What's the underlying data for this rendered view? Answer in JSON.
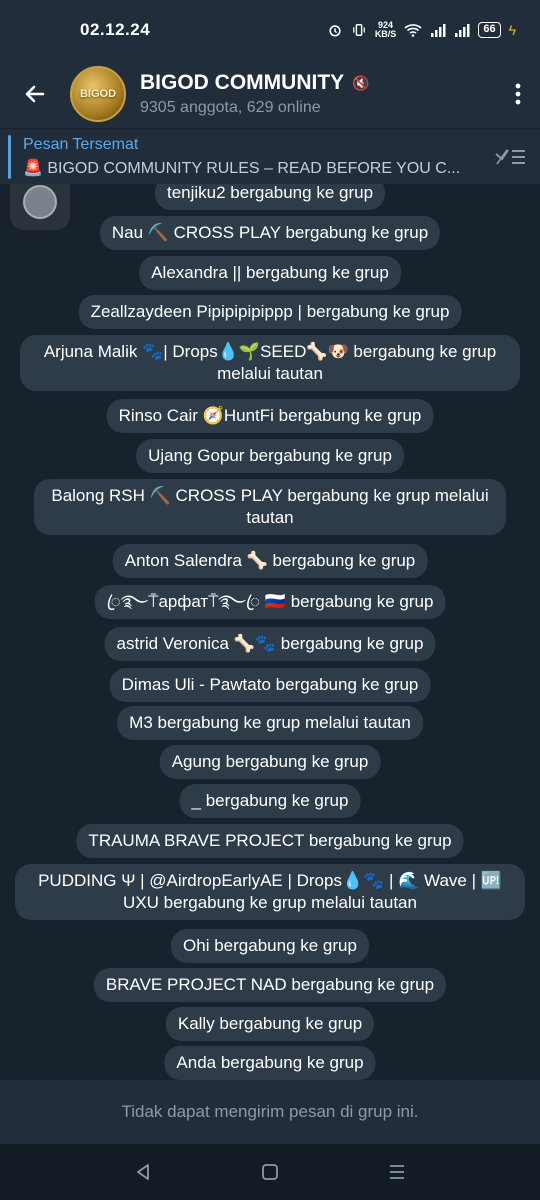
{
  "status_bar": {
    "time": "02.12.24",
    "net_speed_value": "924",
    "net_speed_unit": "KB/S",
    "battery": "66"
  },
  "header": {
    "avatar_text": "BIGOD",
    "title": "BIGOD COMMUNITY",
    "subtitle": "9305 anggota, 629 online"
  },
  "pinned": {
    "label": "Pesan Tersemat",
    "message": "🚨 BIGOD COMMUNITY RULES – READ BEFORE YOU C..."
  },
  "messages": [
    "tenjiku2 bergabung ke grup",
    "Nau ⛏️ CROSS PLAY bergabung ke grup",
    "Alexandra || bergabung ke grup",
    "Zeallzaydeen Pipipipipippp | bergabung ke grup",
    "Arjuna Malik 🐾| Drops💧🌱SEED🦴🐶 bergabung ke grup melalui tautan",
    "Rinso Cair 🧭HuntFi bergabung ke grup",
    "Ujang Gopur bergabung ke grup",
    "Balong RSH ⛏️ CROSS PLAY bergabung ke grup melalui tautan",
    "Anton Salendra 🦴 bergabung ke grup",
    "ꦿ࿐⍑арфат⍑࿐ꦿ 🇷🇺 bergabung ke grup",
    "astrid Veronica 🦴🐾 bergabung ke grup",
    "Dimas Uli - Pawtato bergabung ke grup",
    "M3 bergabung ke grup melalui tautan",
    "Agung bergabung ke grup",
    "_ bergabung ke grup",
    "TRAUMA BRAVE PROJECT bergabung ke grup",
    "PUDDING Ψ | @AirdropEarlyAE | Drops💧🐾 | 🌊 Wave | 🆙 UXU bergabung ke grup melalui tautan",
    "Ohi bergabung ke grup",
    "BRAVE PROJECT NAD bergabung ke grup",
    "Kally bergabung ke grup",
    "Anda bergabung ke grup"
  ],
  "bottom_bar": {
    "notice": "Tidak dapat mengirim pesan di grup ini."
  },
  "icons": {
    "back": "back-arrow-icon",
    "menu": "more-vertical-icon",
    "unpin": "unpin-list-icon",
    "mute": "muted-speaker-icon"
  }
}
